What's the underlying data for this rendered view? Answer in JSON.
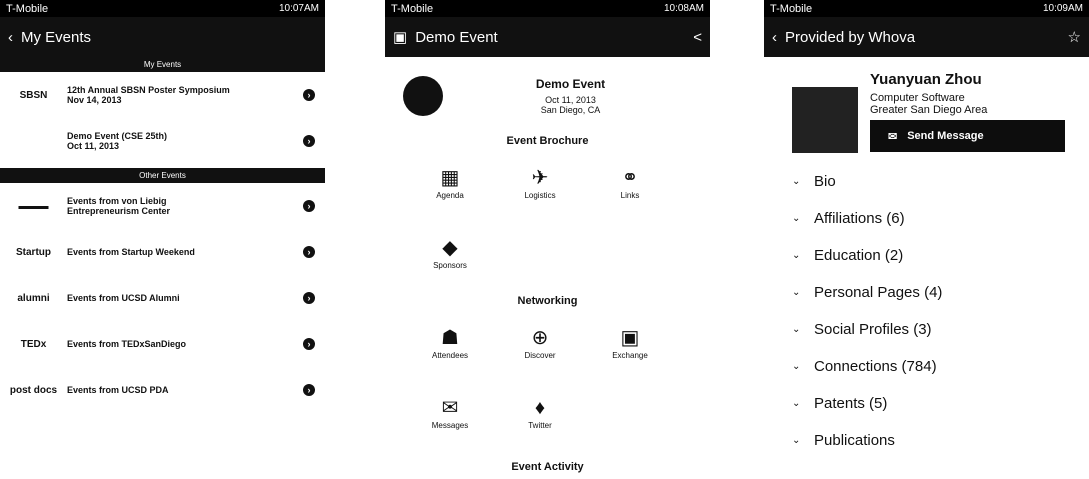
{
  "screen1": {
    "status": {
      "carrier": "T-Mobile",
      "time": "10:07AM"
    },
    "title": "My Events",
    "my_events_header": "My Events",
    "my_events": [
      {
        "logo": "SBSN",
        "text": "12th Annual SBSN Poster Symposium\nNov 14, 2013"
      },
      {
        "logo": "",
        "text": "Demo Event (CSE 25th)\nOct 11, 2013"
      }
    ],
    "other_events_header": "Other Events",
    "other_events": [
      {
        "logo": "▬▬▬",
        "text": "Events from von Liebig\nEntrepreneurism Center"
      },
      {
        "logo": "Startup",
        "text": "Events from Startup Weekend"
      },
      {
        "logo": "alumni",
        "text": "Events from UCSD Alumni"
      },
      {
        "logo": "TEDx",
        "text": "Events from TEDxSanDiego"
      },
      {
        "logo": "post docs",
        "text": "Events from UCSD PDA"
      }
    ]
  },
  "screen2": {
    "status": {
      "carrier": "T-Mobile",
      "time": "10:08AM"
    },
    "title": "Demo Event",
    "event_name": "Demo Event",
    "event_date": "Oct 11, 2013",
    "event_location": "San Diego, CA",
    "brochure_title": "Event Brochure",
    "brochure": [
      {
        "icon": "calendar-icon",
        "glyph": "▦",
        "label": "Agenda"
      },
      {
        "icon": "plane-icon",
        "glyph": "✈",
        "label": "Logistics"
      },
      {
        "icon": "link-icon",
        "glyph": "⚭",
        "label": "Links"
      },
      {
        "icon": "tag-icon",
        "glyph": "◆",
        "label": "Sponsors"
      }
    ],
    "networking_title": "Networking",
    "networking": [
      {
        "icon": "people-icon",
        "glyph": "☗",
        "label": "Attendees"
      },
      {
        "icon": "magnify-icon",
        "glyph": "⊕",
        "label": "Discover"
      },
      {
        "icon": "exchange-icon",
        "glyph": "▣",
        "label": "Exchange"
      },
      {
        "icon": "mail-icon",
        "glyph": "✉",
        "label": "Messages"
      },
      {
        "icon": "twitter-icon",
        "glyph": "♦",
        "label": "Twitter"
      }
    ],
    "activity_title": "Event Activity"
  },
  "screen3": {
    "status": {
      "carrier": "T-Mobile",
      "time": "10:09AM"
    },
    "title": "Provided by Whova",
    "name": "Yuanyuan Zhou",
    "line1": "Computer Software",
    "line2": "Greater San Diego Area",
    "send_label": "Send Message",
    "sections": [
      "Bio",
      "Affiliations (6)",
      "Education (2)",
      "Personal Pages (4)",
      "Social Profiles (3)",
      "Connections (784)",
      "Patents (5)",
      "Publications"
    ]
  }
}
